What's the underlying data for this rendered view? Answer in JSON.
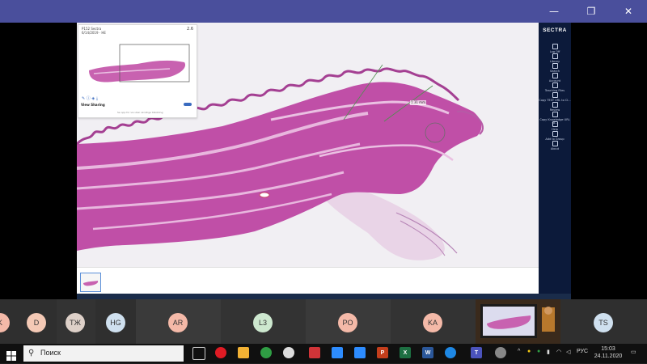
{
  "window": {
    "minimize_glyph": "—",
    "maximize_glyph": "❐",
    "close_glyph": "✕"
  },
  "viewer": {
    "thumbnail_title": "P152 Sectra",
    "thumbnail_subtitle": "6/14/2019 · HE",
    "zoom": "2.6",
    "view_sharing_label": "View Sharing",
    "view_sharing_info": "Se opp for vis uten skrollige tilkobling",
    "measure_label": "1.31 mm"
  },
  "sidebar": {
    "logo": "SECTRA",
    "items": [
      {
        "label": "Log Off"
      },
      {
        "label": "Library"
      },
      {
        "label": "Search"
      },
      {
        "label": "Account"
      },
      {
        "label": "Teaching Files"
      },
      {
        "label": "Copy TEST URL to Cl..."
      },
      {
        "label": "Review"
      },
      {
        "label": "Copy Knowledge URL to..."
      },
      {
        "label": "Help"
      },
      {
        "label": "Add to Group"
      },
      {
        "label": "About"
      }
    ]
  },
  "participants": [
    {
      "initials": "K",
      "color": "#f4b9a8"
    },
    {
      "initials": "D",
      "color": "#f4c9b5"
    },
    {
      "initials": "ТЖ",
      "color": "#ddd0c8"
    },
    {
      "initials": "HG",
      "color": "#cfe0ef"
    },
    {
      "initials": "AR",
      "color": "#f4b9a8"
    },
    {
      "initials": "L3",
      "color": "#cde8cf"
    },
    {
      "initials": "PO",
      "color": "#f4b9a8"
    },
    {
      "initials": "KA",
      "color": "#f4b9a8"
    },
    {
      "initials": "TS",
      "color": "#cfe0ef"
    }
  ],
  "taskbar": {
    "search_placeholder": "Поиск",
    "language": "РУС",
    "time": "15:03",
    "date": "24.11.2020"
  }
}
